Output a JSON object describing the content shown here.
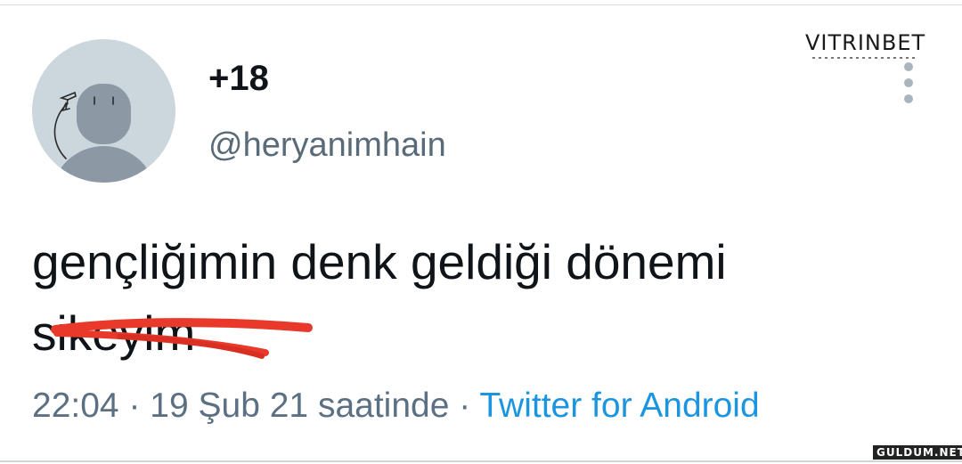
{
  "tweet": {
    "display_name": "+18",
    "handle": "@heryanimhain",
    "text_line1": "gençliğimin denk geldiği dönemi",
    "text_line2": "sikeyim",
    "time": "22:04",
    "separator": " · ",
    "date_phrase": "19 Şub 21 saatinde",
    "source": "Twitter for Android"
  },
  "watermarks": {
    "top": "VITRINBET",
    "bottom": "GULDUM.NET"
  },
  "icons": {
    "avatar": "default-avatar-icon",
    "more": "more-vertical-icon"
  },
  "colors": {
    "text": "#0f1419",
    "secondary": "#5b7083",
    "link": "#1b95e0",
    "avatar_bg": "#ccd6dd",
    "avatar_fg": "#8899a6",
    "scribble": "#e8392b"
  }
}
